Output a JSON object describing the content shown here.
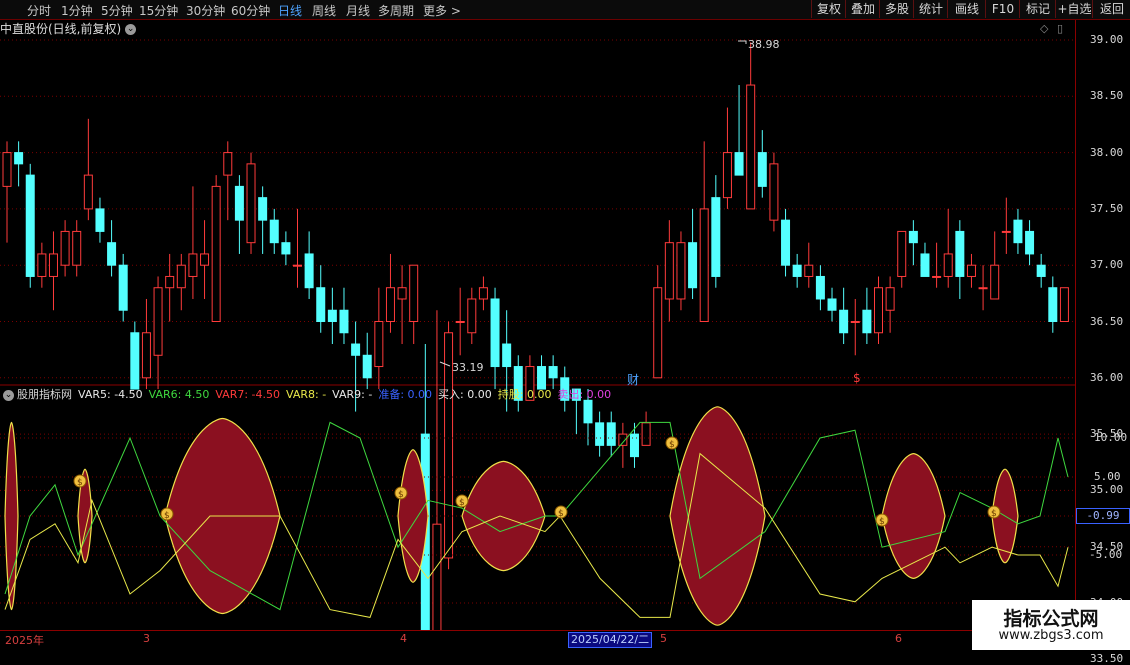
{
  "toolbar": {
    "timeframes": [
      {
        "label": "分时",
        "active": false
      },
      {
        "label": "1分钟",
        "active": false
      },
      {
        "label": "5分钟",
        "active": false
      },
      {
        "label": "15分钟",
        "active": false
      },
      {
        "label": "30分钟",
        "active": false
      },
      {
        "label": "60分钟",
        "active": false
      },
      {
        "label": "日线",
        "active": true
      },
      {
        "label": "周线",
        "active": false
      },
      {
        "label": "月线",
        "active": false
      },
      {
        "label": "多周期",
        "active": false
      },
      {
        "label": "更多 >",
        "active": false
      }
    ],
    "right_buttons": [
      "复权",
      "叠加",
      "多股",
      "统计",
      "画线",
      "F10",
      "标记",
      "+自选",
      "返回"
    ]
  },
  "chart_title": "中直股份(日线,前复权)",
  "price_axis": [
    "39.00",
    "38.50",
    "38.00",
    "37.50",
    "37.00",
    "36.50",
    "36.00",
    "35.50",
    "35.00",
    "34.50",
    "34.00",
    "33.50"
  ],
  "high_label": "38.98",
  "low_label": "33.19",
  "markers": {
    "cai": "财",
    "dollar": "$"
  },
  "indicator": {
    "name": "股朋指标网",
    "items": [
      {
        "label": "VAR5: -4.50",
        "color": "#e8e8e8"
      },
      {
        "label": "VAR6: 4.50",
        "color": "#3fd83f"
      },
      {
        "label": "VAR7: -4.50",
        "color": "#ff3b3b"
      },
      {
        "label": "VAR8: -",
        "color": "#e8e84a"
      },
      {
        "label": "VAR9: -",
        "color": "#e8e8e8"
      },
      {
        "label": "准备: 0.00",
        "color": "#3a62ff"
      },
      {
        "label": "买入: 0.00",
        "color": "#e8e8e8"
      },
      {
        "label": "持股: 0.00",
        "color": "#e8e84a"
      },
      {
        "label": "卖出: 0.00",
        "color": "#e040e0"
      }
    ],
    "axis": [
      "10.00",
      "5.00",
      "-5.00"
    ],
    "current_value": "-0.99"
  },
  "x_axis": {
    "labels": [
      "2025年",
      "3",
      "4",
      "5",
      "6"
    ],
    "selected_date": "2025/04/22/二"
  },
  "watermark": {
    "line1": "指标公式网",
    "line2": "www.zbgs3.com"
  },
  "chart_data": {
    "type": "candlestick",
    "price_range": [
      33.0,
      39.3
    ],
    "candles": [
      {
        "o": 37.7,
        "c": 38.0,
        "h": 38.1,
        "l": 37.2
      },
      {
        "o": 38.0,
        "c": 37.9,
        "h": 38.1,
        "l": 37.7
      },
      {
        "o": 37.8,
        "c": 36.9,
        "h": 37.9,
        "l": 36.8
      },
      {
        "o": 36.9,
        "c": 37.1,
        "h": 37.2,
        "l": 36.8
      },
      {
        "o": 36.9,
        "c": 37.1,
        "h": 37.3,
        "l": 36.6
      },
      {
        "o": 37.0,
        "c": 37.3,
        "h": 37.4,
        "l": 36.9
      },
      {
        "o": 37.0,
        "c": 37.3,
        "h": 37.4,
        "l": 36.9
      },
      {
        "o": 37.5,
        "c": 37.8,
        "h": 38.3,
        "l": 37.4
      },
      {
        "o": 37.5,
        "c": 37.3,
        "h": 37.6,
        "l": 37.2
      },
      {
        "o": 37.2,
        "c": 37.0,
        "h": 37.4,
        "l": 36.9
      },
      {
        "o": 37.0,
        "c": 36.6,
        "h": 37.1,
        "l": 36.5
      },
      {
        "o": 36.4,
        "c": 35.9,
        "h": 36.5,
        "l": 35.9
      },
      {
        "o": 36.0,
        "c": 36.4,
        "h": 36.7,
        "l": 35.9
      },
      {
        "o": 36.2,
        "c": 36.8,
        "h": 36.9,
        "l": 35.9
      },
      {
        "o": 36.8,
        "c": 36.9,
        "h": 37.1,
        "l": 36.5
      },
      {
        "o": 36.8,
        "c": 37.0,
        "h": 37.1,
        "l": 36.6
      },
      {
        "o": 36.9,
        "c": 37.1,
        "h": 37.7,
        "l": 36.7
      },
      {
        "o": 37.0,
        "c": 37.1,
        "h": 37.4,
        "l": 36.7
      },
      {
        "o": 36.5,
        "c": 37.7,
        "h": 37.8,
        "l": 36.5
      },
      {
        "o": 37.8,
        "c": 38.0,
        "h": 38.1,
        "l": 37.4
      },
      {
        "o": 37.7,
        "c": 37.4,
        "h": 37.8,
        "l": 37.1
      },
      {
        "o": 37.2,
        "c": 37.9,
        "h": 38.0,
        "l": 37.1
      },
      {
        "o": 37.6,
        "c": 37.4,
        "h": 37.7,
        "l": 37.1
      },
      {
        "o": 37.4,
        "c": 37.2,
        "h": 37.5,
        "l": 37.1
      },
      {
        "o": 37.2,
        "c": 37.1,
        "h": 37.3,
        "l": 37.0
      },
      {
        "o": 37.0,
        "c": 37.0,
        "h": 37.5,
        "l": 36.8
      },
      {
        "o": 37.1,
        "c": 36.8,
        "h": 37.3,
        "l": 36.7
      },
      {
        "o": 36.8,
        "c": 36.5,
        "h": 37.0,
        "l": 36.4
      },
      {
        "o": 36.6,
        "c": 36.5,
        "h": 36.8,
        "l": 36.3
      },
      {
        "o": 36.6,
        "c": 36.4,
        "h": 36.8,
        "l": 36.3
      },
      {
        "o": 36.3,
        "c": 36.2,
        "h": 36.5,
        "l": 35.7
      },
      {
        "o": 36.2,
        "c": 36.0,
        "h": 36.4,
        "l": 35.9
      },
      {
        "o": 36.1,
        "c": 36.5,
        "h": 36.8,
        "l": 35.9
      },
      {
        "o": 36.5,
        "c": 36.8,
        "h": 37.1,
        "l": 36.4
      },
      {
        "o": 36.7,
        "c": 36.8,
        "h": 37.0,
        "l": 36.3
      },
      {
        "o": 36.5,
        "c": 37.0,
        "h": 37.0,
        "l": 36.3
      },
      {
        "o": 35.5,
        "c": 33.6,
        "h": 36.3,
        "l": 33.2
      },
      {
        "o": 33.7,
        "c": 34.7,
        "h": 36.6,
        "l": 33.5
      },
      {
        "o": 34.4,
        "c": 36.4,
        "h": 36.5,
        "l": 34.3
      },
      {
        "o": 36.5,
        "c": 36.5,
        "h": 36.8,
        "l": 36.2
      },
      {
        "o": 36.4,
        "c": 36.7,
        "h": 36.8,
        "l": 36.3
      },
      {
        "o": 36.7,
        "c": 36.8,
        "h": 36.9,
        "l": 36.6
      },
      {
        "o": 36.7,
        "c": 36.1,
        "h": 36.8,
        "l": 35.9
      },
      {
        "o": 36.3,
        "c": 36.1,
        "h": 36.6,
        "l": 35.7
      },
      {
        "o": 36.1,
        "c": 35.8,
        "h": 36.2,
        "l": 35.7
      },
      {
        "o": 35.8,
        "c": 36.1,
        "h": 36.2,
        "l": 35.8
      },
      {
        "o": 36.1,
        "c": 35.9,
        "h": 36.2,
        "l": 35.9
      },
      {
        "o": 36.1,
        "c": 36.0,
        "h": 36.2,
        "l": 35.9
      },
      {
        "o": 36.0,
        "c": 35.8,
        "h": 36.1,
        "l": 35.7
      },
      {
        "o": 35.9,
        "c": 35.8,
        "h": 35.9,
        "l": 35.5
      },
      {
        "o": 35.8,
        "c": 35.6,
        "h": 35.9,
        "l": 35.4
      },
      {
        "o": 35.6,
        "c": 35.4,
        "h": 35.7,
        "l": 35.3
      },
      {
        "o": 35.6,
        "c": 35.4,
        "h": 35.7,
        "l": 35.3
      },
      {
        "o": 35.4,
        "c": 35.5,
        "h": 35.6,
        "l": 35.2
      },
      {
        "o": 35.5,
        "c": 35.3,
        "h": 35.6,
        "l": 35.2
      },
      {
        "o": 35.4,
        "c": 35.6,
        "h": 35.7,
        "l": 35.4
      },
      {
        "o": 36.0,
        "c": 36.8,
        "h": 37.0,
        "l": 36.0
      },
      {
        "o": 36.7,
        "c": 37.2,
        "h": 37.4,
        "l": 36.5
      },
      {
        "o": 36.7,
        "c": 37.2,
        "h": 37.3,
        "l": 36.6
      },
      {
        "o": 37.2,
        "c": 36.8,
        "h": 37.5,
        "l": 36.7
      },
      {
        "o": 36.5,
        "c": 37.5,
        "h": 38.1,
        "l": 36.5
      },
      {
        "o": 37.6,
        "c": 36.9,
        "h": 37.8,
        "l": 36.8
      },
      {
        "o": 37.6,
        "c": 38.0,
        "h": 38.4,
        "l": 37.5
      },
      {
        "o": 38.0,
        "c": 37.8,
        "h": 38.6,
        "l": 37.8
      },
      {
        "o": 37.5,
        "c": 38.6,
        "h": 38.98,
        "l": 37.5
      },
      {
        "o": 38.0,
        "c": 37.7,
        "h": 38.2,
        "l": 37.6
      },
      {
        "o": 37.4,
        "c": 37.9,
        "h": 38.0,
        "l": 37.3
      },
      {
        "o": 37.4,
        "c": 37.0,
        "h": 37.5,
        "l": 36.9
      },
      {
        "o": 37.0,
        "c": 36.9,
        "h": 37.1,
        "l": 36.8
      },
      {
        "o": 36.9,
        "c": 37.0,
        "h": 37.2,
        "l": 36.8
      },
      {
        "o": 36.9,
        "c": 36.7,
        "h": 37.0,
        "l": 36.6
      },
      {
        "o": 36.7,
        "c": 36.6,
        "h": 36.8,
        "l": 36.5
      },
      {
        "o": 36.6,
        "c": 36.4,
        "h": 36.8,
        "l": 36.3
      },
      {
        "o": 36.5,
        "c": 36.5,
        "h": 36.7,
        "l": 36.2
      },
      {
        "o": 36.6,
        "c": 36.4,
        "h": 36.8,
        "l": 36.3
      },
      {
        "o": 36.4,
        "c": 36.8,
        "h": 36.9,
        "l": 36.3
      },
      {
        "o": 36.6,
        "c": 36.8,
        "h": 36.9,
        "l": 36.4
      },
      {
        "o": 36.9,
        "c": 37.3,
        "h": 37.3,
        "l": 36.8
      },
      {
        "o": 37.3,
        "c": 37.2,
        "h": 37.4,
        "l": 37.0
      },
      {
        "o": 37.1,
        "c": 36.9,
        "h": 37.2,
        "l": 36.9
      },
      {
        "o": 36.9,
        "c": 36.9,
        "h": 37.2,
        "l": 36.8
      },
      {
        "o": 36.9,
        "c": 37.1,
        "h": 37.5,
        "l": 36.8
      },
      {
        "o": 37.3,
        "c": 36.9,
        "h": 37.4,
        "l": 36.7
      },
      {
        "o": 36.9,
        "c": 37.0,
        "h": 37.1,
        "l": 36.8
      },
      {
        "o": 36.8,
        "c": 36.8,
        "h": 37.0,
        "l": 36.6
      },
      {
        "o": 36.7,
        "c": 37.0,
        "h": 37.3,
        "l": 36.7
      },
      {
        "o": 37.3,
        "c": 37.3,
        "h": 37.6,
        "l": 37.1
      },
      {
        "o": 37.4,
        "c": 37.2,
        "h": 37.5,
        "l": 37.1
      },
      {
        "o": 37.3,
        "c": 37.1,
        "h": 37.4,
        "l": 37.0
      },
      {
        "o": 37.0,
        "c": 36.9,
        "h": 37.1,
        "l": 36.8
      },
      {
        "o": 36.8,
        "c": 36.5,
        "h": 36.9,
        "l": 36.4
      },
      {
        "o": 36.5,
        "c": 36.8,
        "h": 36.8,
        "l": 36.5
      }
    ]
  }
}
